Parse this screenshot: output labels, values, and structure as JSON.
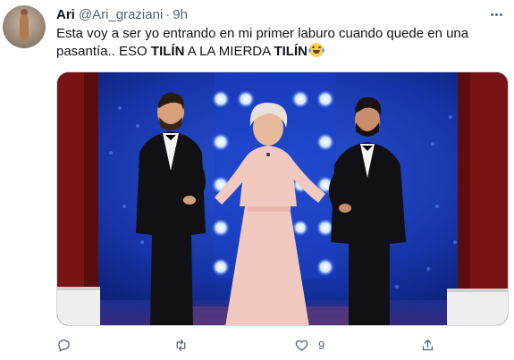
{
  "tweet": {
    "display_name": "Ari",
    "handle": "@Ari_graziani",
    "separator": "·",
    "time": "9h",
    "text_line1": "Esta voy a ser yo entrando en mi primer laburo cuando quede en una",
    "text_part1": "pasantía.. ESO ",
    "text_bold1": "TILÍN",
    "text_part2": " A LA MIERDA ",
    "text_bold2": "TILÍN",
    "emoji": "face-with-tears-of-joy",
    "likes": "9"
  },
  "icons": {
    "more": "more-icon",
    "reply": "reply-icon",
    "retweet": "retweet-icon",
    "like": "like-icon",
    "share": "share-icon"
  },
  "colors": {
    "text": "#0f1419",
    "secondary": "#536471",
    "border": "#cfd9de",
    "stage_blue": "#1b3bb8",
    "curtain_red": "#7a1414",
    "dress": "#f2c9c0"
  }
}
